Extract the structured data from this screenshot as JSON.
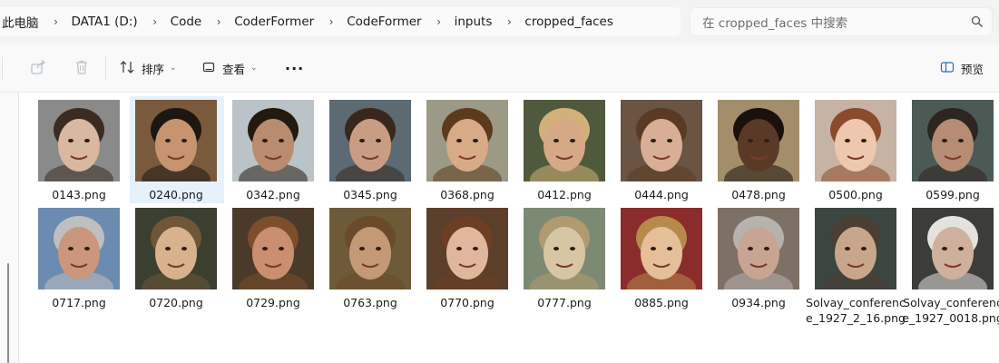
{
  "breadcrumb": [
    "此电脑",
    "DATA1 (D:)",
    "Code",
    "CoderFormer",
    "CodeFormer",
    "inputs",
    "cropped_faces"
  ],
  "search": {
    "placeholder": "在 cropped_faces 中搜索",
    "icon": "search-icon"
  },
  "toolbar": {
    "sort_label": "排序",
    "view_label": "查看",
    "more_label": "···",
    "preview_label": "预览"
  },
  "files": [
    {
      "name": "0143.png",
      "bg": "#8a8a8a",
      "skin": "#d9b7a0",
      "hair": "#3b2c22"
    },
    {
      "name": "0240.png",
      "bg": "#7a5a3c",
      "skin": "#c79470",
      "hair": "#1d1712",
      "selected": true
    },
    {
      "name": "0342.png",
      "bg": "#b9c3c8",
      "skin": "#b98b6f",
      "hair": "#24190f"
    },
    {
      "name": "0345.png",
      "bg": "#5b6a73",
      "skin": "#c99d84",
      "hair": "#3a271b"
    },
    {
      "name": "0368.png",
      "bg": "#9c9a86",
      "skin": "#d8aa86",
      "hair": "#5c3b1d"
    },
    {
      "name": "0412.png",
      "bg": "#4f5a3c",
      "skin": "#d5a985",
      "hair": "#d2b178"
    },
    {
      "name": "0444.png",
      "bg": "#6a5444",
      "skin": "#d9ae96",
      "hair": "#5a3a25"
    },
    {
      "name": "0478.png",
      "bg": "#a38e6c",
      "skin": "#5a3a27",
      "hair": "#1a110c"
    },
    {
      "name": "0500.png",
      "bg": "#c7b3a4",
      "skin": "#edc7ae",
      "hair": "#8a4b2a"
    },
    {
      "name": "0599.png",
      "bg": "#4c5a56",
      "skin": "#b78c74",
      "hair": "#2e2520"
    },
    {
      "name": "0717.png",
      "bg": "#6b8bb0",
      "skin": "#c9977b",
      "hair": "#bfbfbf"
    },
    {
      "name": "0720.png",
      "bg": "#3a3f30",
      "skin": "#d8b28c",
      "hair": "#6e5636"
    },
    {
      "name": "0729.png",
      "bg": "#4a3a2a",
      "skin": "#c98f6e",
      "hair": "#7c4e2a"
    },
    {
      "name": "0763.png",
      "bg": "#6d5a38",
      "skin": "#c49a76",
      "hair": "#6a4a2a"
    },
    {
      "name": "0770.png",
      "bg": "#5c3f2b",
      "skin": "#e0b79c",
      "hair": "#6c3e22"
    },
    {
      "name": "0777.png",
      "bg": "#7d8a73",
      "skin": "#d7c6a4",
      "hair": "#b09a6e"
    },
    {
      "name": "0885.png",
      "bg": "#8a2c2c",
      "skin": "#e4bf98",
      "hair": "#b58a4c"
    },
    {
      "name": "0934.png",
      "bg": "#7d7064",
      "skin": "#c8a592",
      "hair": "#b7b2ae"
    },
    {
      "name": "Solvay_conference_1927_2_16.png",
      "bg": "#3b4640",
      "skin": "#c9a68a",
      "hair": "#4b3e33"
    },
    {
      "name": "Solvay_conference_1927_0018.png",
      "bg": "#3c3c38",
      "skin": "#cfb09c",
      "hair": "#e4e2de"
    }
  ]
}
